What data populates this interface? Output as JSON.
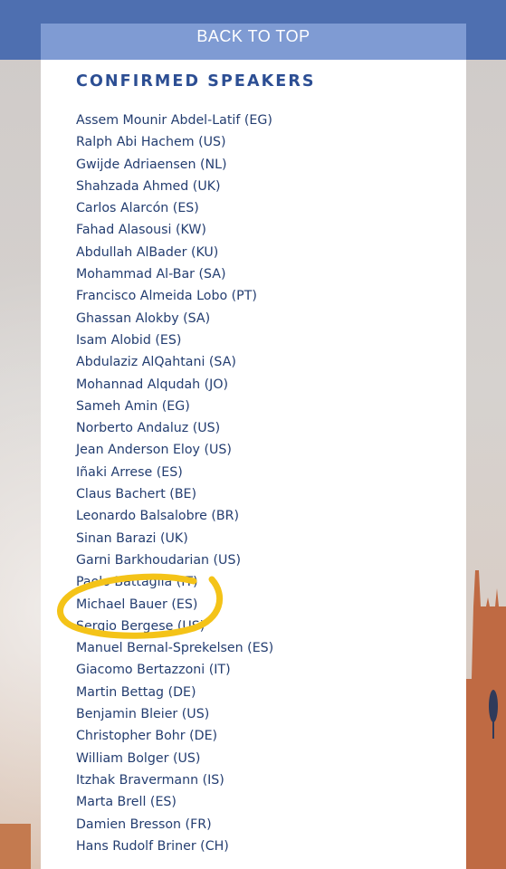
{
  "back_to_top": "BACK TO TOP",
  "section_title": "CONFIRMED SPEAKERS",
  "speakers": [
    "Assem Mounir Abdel-Latif (EG)",
    "Ralph Abi Hachem (US)",
    "Gwijde Adriaensen (NL)",
    "Shahzada Ahmed (UK)",
    "Carlos Alarcón (ES)",
    "Fahad Alasousi (KW)",
    "Abdullah AlBader (KU)",
    "Mohammad Al-Bar (SA)",
    "Francisco Almeida Lobo (PT)",
    "Ghassan Alokby (SA)",
    "Isam Alobid (ES)",
    "Abdulaziz AlQahtani (SA)",
    "Mohannad Alqudah (JO)",
    "Sameh Amin (EG)",
    "Norberto Andaluz (US)",
    "Jean Anderson Eloy (US)",
    "Iñaki Arrese (ES)",
    "Claus Bachert (BE)",
    "Leonardo Balsalobre (BR)",
    "Sinan Barazi (UK)",
    "Garni Barkhoudarian (US)",
    "Paolo Battaglia (IT)",
    "Michael Bauer (ES)",
    "Sergio Bergese (US)",
    "Manuel Bernal-Sprekelsen (ES)",
    "Giacomo Bertazzoni (IT)",
    "Martin Bettag (DE)",
    "Benjamin Bleier (US)",
    "Christopher Bohr (DE)",
    "William Bolger (US)",
    "Itzhak Bravermann (IS)",
    "Marta Brell (ES)",
    "Damien Bresson (FR)",
    "Hans Rudolf Briner (CH)"
  ],
  "colors": {
    "header_bar": "#4e6fb0",
    "back_to_top_bg": "#7f9bd3",
    "title": "#2c4e93",
    "list_text": "#233d70",
    "highlight_stroke": "#f4c318"
  }
}
